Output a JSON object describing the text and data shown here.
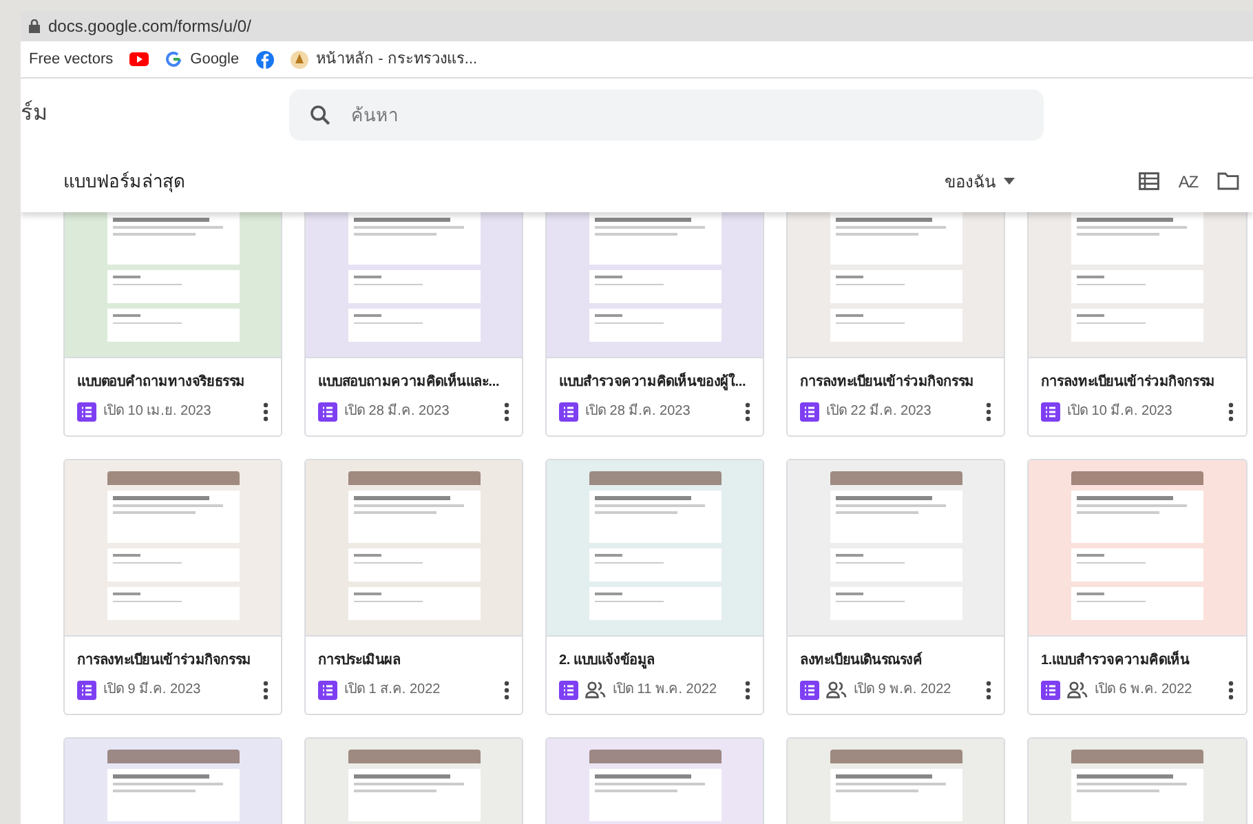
{
  "browser": {
    "url": "docs.google.com/forms/u/0/",
    "bookmarks": [
      {
        "kind": "text",
        "label": "Free vectors"
      },
      {
        "kind": "youtube"
      },
      {
        "kind": "google",
        "label": "Google"
      },
      {
        "kind": "facebook"
      },
      {
        "kind": "site",
        "label": "หน้าหลัก - กระทรวงแร..."
      }
    ]
  },
  "app": {
    "title_fragment": "ร์ม",
    "search": {
      "placeholder": "ค้นหา"
    }
  },
  "section": {
    "title": "แบบฟอร์มล่าสุด",
    "owner_filter": "ของฉัน",
    "sort_label": "AZ"
  },
  "cards": [
    {
      "title": "แบบตอบคำถามทางจริยธรรม",
      "date": "เปิด 10 เม.ย. 2023",
      "shared": false,
      "color": "#dcebd9"
    },
    {
      "title": "แบบสอบถามความคิดเห็นและ...",
      "date": "เปิด 28 มี.ค. 2023",
      "shared": false,
      "color": "#e7e2f3"
    },
    {
      "title": "แบบสำรวจความคิดเห็นของผู้ใ...",
      "date": "เปิด 28 มี.ค. 2023",
      "shared": false,
      "color": "#e7e2f3"
    },
    {
      "title": "การลงทะเบียนเข้าร่วมกิจกรรม",
      "date": "เปิด 22 มี.ค. 2023",
      "shared": false,
      "color": "#efebe8"
    },
    {
      "title": "การลงทะเบียนเข้าร่วมกิจกรรม",
      "date": "เปิด 10 มี.ค. 2023",
      "shared": false,
      "color": "#efebe8"
    },
    {
      "title": "การลงทะเบียนเข้าร่วมกิจกรรม",
      "date": "เปิด 9 มี.ค. 2023",
      "shared": false,
      "color": "#f1ece7"
    },
    {
      "title": "การประเมินผล",
      "date": "เปิด 1 ส.ค. 2022",
      "shared": false,
      "color": "#efe9e3"
    },
    {
      "title": "2. แบบแจ้งข้อมูล",
      "date": "เปิด 11 พ.ค. 2022",
      "shared": true,
      "color": "#e3eeee"
    },
    {
      "title": "ลงทะเบียนเดินรณรงค์",
      "date": "เปิด 9 พ.ค. 2022",
      "shared": true,
      "color": "#eeeeee"
    },
    {
      "title": "1.แบบสำรวจความคิดเห็น",
      "date": "เปิด 6 พ.ค. 2022",
      "shared": true,
      "color": "#fbe1dc"
    },
    {
      "color": "#e6e6f5"
    },
    {
      "color": "#ecece8"
    },
    {
      "color": "#ebe5f6"
    },
    {
      "color": "#ecece8"
    },
    {
      "color": "#ecece8"
    }
  ]
}
